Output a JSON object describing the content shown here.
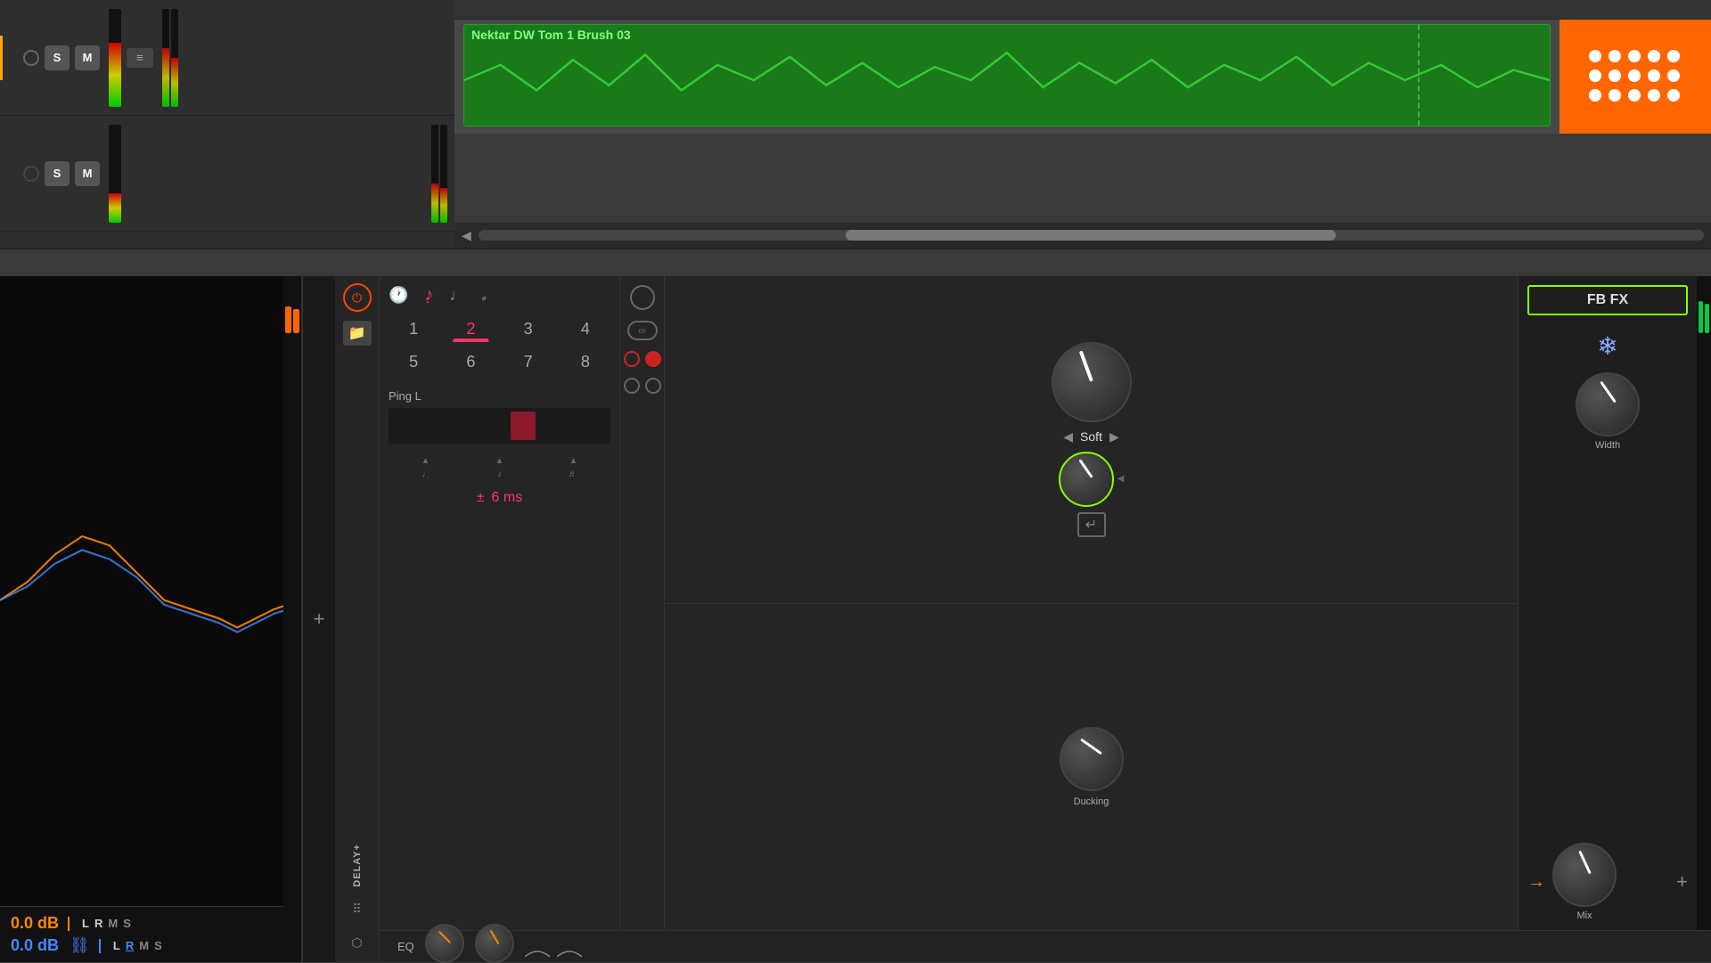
{
  "daw": {
    "track1": {
      "solo_label": "S",
      "mute_label": "M",
      "clip_name": "Nektar DW Tom 1 Brush 03"
    },
    "track2": {
      "solo_label": "S",
      "mute_label": "M"
    },
    "scrollbar": {
      "left_arrow": "◀"
    }
  },
  "analyzer": {
    "level1_value": "0.0 dB",
    "level2_value": "0.0 dB",
    "ch1_l": "L",
    "ch1_r": "R",
    "ch1_m": "M",
    "ch1_s": "S",
    "ch2_l": "L",
    "ch2_r": "R",
    "ch2_m": "M",
    "ch2_s": "S"
  },
  "plugin": {
    "delay_label": "DELAY+",
    "power_symbol": "⏻",
    "folder_symbol": "🗁",
    "dots_symbol": "⋯",
    "key_symbol": "⬡",
    "tab_label": "Ping L",
    "timing": {
      "note_icons": [
        "♩.",
        "♪",
        "♩",
        "𝅗"
      ],
      "numbers": [
        "1",
        "2",
        "3",
        "4",
        "5",
        "6",
        "7",
        "8"
      ],
      "active_number": "2",
      "ms_prefix": "±",
      "ms_value": "6 ms"
    },
    "eq": {
      "label": "EQ"
    },
    "mode": {
      "soft_label": "Soft",
      "left_arrow": "◀",
      "right_arrow": "▶",
      "retrigger_symbol": "↵"
    },
    "fbfx": {
      "title": "FB FX",
      "freeze_symbol": "✲",
      "width_label": "Width",
      "ducking_label": "Ducking",
      "mix_label": "Mix",
      "add_symbol": "+"
    }
  }
}
